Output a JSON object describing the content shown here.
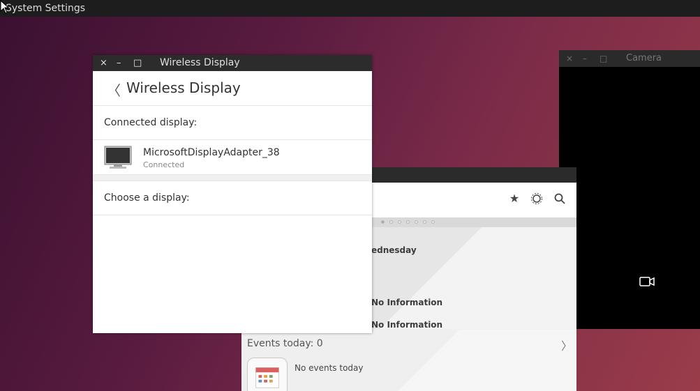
{
  "topbar": {
    "title": "System Settings"
  },
  "camera": {
    "title": "Camera",
    "close": "×",
    "min": "–",
    "max": "□"
  },
  "back_window": {
    "day_text": "ednesday",
    "info1": "No Information",
    "info2": "No Information",
    "events_label": "Events today: 0",
    "no_events": "No events today",
    "chevron": "〉",
    "icons": [
      "star-icon",
      "gear-icon",
      "search-icon"
    ]
  },
  "wireless": {
    "window_title": "Wireless Display",
    "close": "×",
    "min": "–",
    "max": "□",
    "back": "〈",
    "header": "Wireless Display",
    "connected_section": "Connected display:",
    "device_name": "MicrosoftDisplayAdapter_38",
    "device_status": "Connected",
    "choose_section": "Choose a display:"
  },
  "colors": {
    "titlebar": "#2c2c2c",
    "desktop": "#5a1c40"
  }
}
